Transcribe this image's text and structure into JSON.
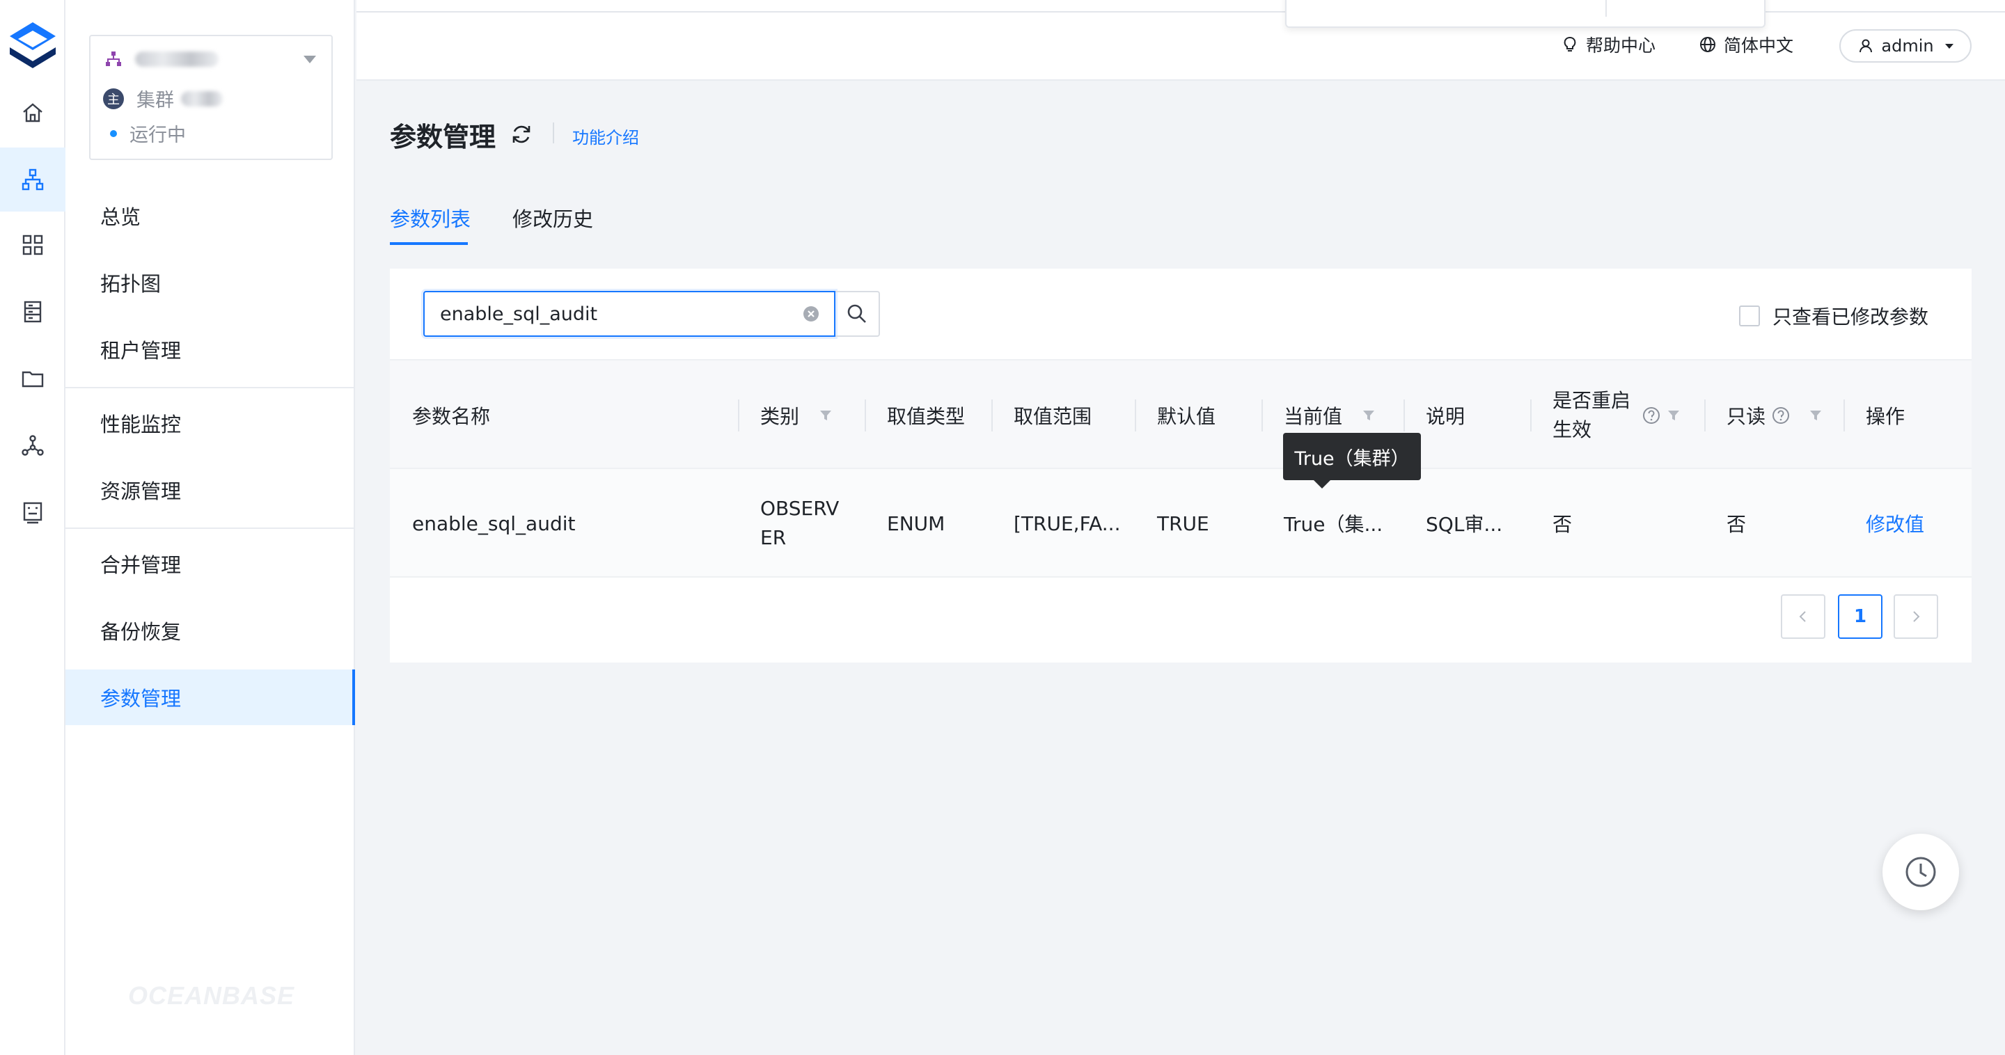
{
  "colors": {
    "accent": "#1677ff",
    "active_bg": "#e6f3ff",
    "tooltip_bg": "#2b2d30"
  },
  "rail": {
    "items": [
      {
        "icon": "home-icon",
        "active": false
      },
      {
        "icon": "cluster-icon",
        "active": true
      },
      {
        "icon": "apps-grid-icon",
        "active": false
      },
      {
        "icon": "server-icon",
        "active": false
      },
      {
        "icon": "folder-icon",
        "active": false
      },
      {
        "icon": "network-icon",
        "active": false
      },
      {
        "icon": "report-icon",
        "active": false
      }
    ]
  },
  "cluster": {
    "role_badge": "主",
    "type_label": "集群",
    "status": "运行中"
  },
  "sidebar": {
    "items": [
      {
        "label": "总览"
      },
      {
        "label": "拓扑图"
      },
      {
        "label": "租户管理"
      },
      {
        "label": "性能监控"
      },
      {
        "label": "资源管理"
      },
      {
        "label": "合并管理"
      },
      {
        "label": "备份恢复"
      },
      {
        "label": "参数管理",
        "active": true
      }
    ],
    "brand": "OCEANBASE"
  },
  "header": {
    "help": "帮助中心",
    "language": "简体中文",
    "user": "admin"
  },
  "page": {
    "title": "参数管理",
    "intro_link": "功能介绍"
  },
  "tabs": [
    {
      "label": "参数列表",
      "active": true
    },
    {
      "label": "修改历史",
      "active": false
    }
  ],
  "search": {
    "value": "enable_sql_audit",
    "placeholder": ""
  },
  "filter": {
    "only_modified_label": "只查看已修改参数",
    "checked": false
  },
  "table": {
    "columns": [
      "参数名称",
      "类别",
      "取值类型",
      "取值范围",
      "默认值",
      "当前值",
      "说明",
      "是否重启生效",
      "只读",
      "操作"
    ],
    "rows": [
      {
        "name": "enable_sql_audit",
        "category": "OBSERVER",
        "value_type": "ENUM",
        "range": "[TRUE,FA...",
        "default": "TRUE",
        "current": "True（集...",
        "description": "SQL审...",
        "restart": "否",
        "readonly": "否",
        "action": "修改值"
      }
    ]
  },
  "tooltip": {
    "text": "True（集群）"
  },
  "pagination": {
    "current": "1"
  }
}
